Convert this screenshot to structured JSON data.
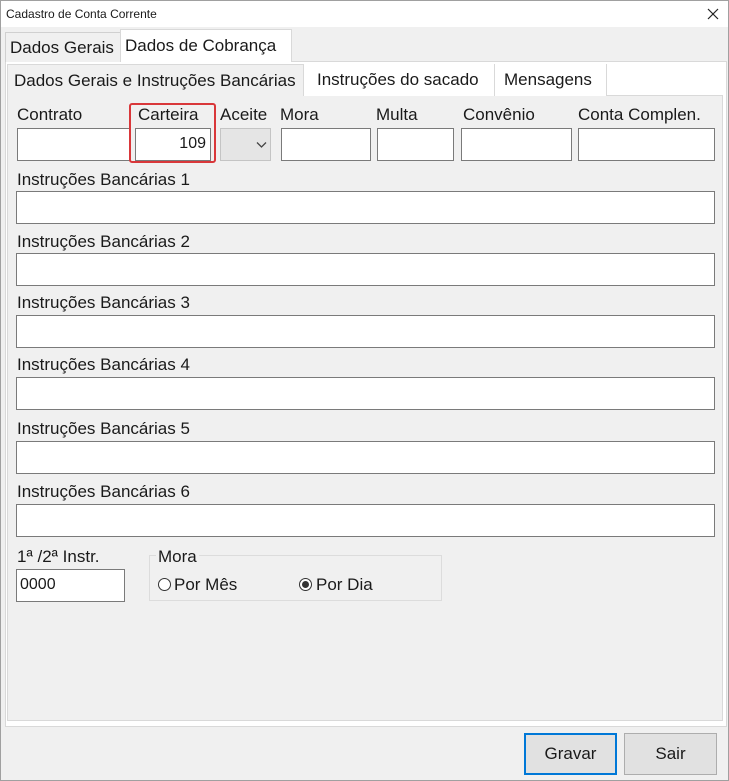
{
  "window": {
    "title": "Cadastro de Conta Corrente"
  },
  "outer_tabs": [
    {
      "label": "Dados Gerais"
    },
    {
      "label": "Dados de Cobrança"
    }
  ],
  "inner_tabs": [
    {
      "label": "Dados Gerais e Instruções Bancárias"
    },
    {
      "label": "Instruções do sacado"
    },
    {
      "label": "Mensagens"
    }
  ],
  "fields": {
    "contrato": {
      "label": "Contrato",
      "value": ""
    },
    "carteira": {
      "label": "Carteira",
      "value": "109"
    },
    "aceite": {
      "label": "Aceite",
      "value": ""
    },
    "mora": {
      "label": "Mora",
      "value": ""
    },
    "multa": {
      "label": "Multa",
      "value": ""
    },
    "convenio": {
      "label": "Convênio",
      "value": ""
    },
    "conta_complen": {
      "label": "Conta Complen.",
      "value": ""
    }
  },
  "instrucoes": [
    {
      "label": "Instruções Bancárias 1",
      "value": ""
    },
    {
      "label": "Instruções Bancárias 2",
      "value": ""
    },
    {
      "label": "Instruções Bancárias 3",
      "value": ""
    },
    {
      "label": "Instruções Bancárias 4",
      "value": ""
    },
    {
      "label": "Instruções Bancárias 5",
      "value": ""
    },
    {
      "label": "Instruções Bancárias 6",
      "value": ""
    }
  ],
  "instr_12": {
    "label": "1ª /2ª Instr.",
    "value": "0000"
  },
  "mora_group": {
    "title": "Mora",
    "options": [
      {
        "label": "Por Mês",
        "checked": false
      },
      {
        "label": "Por Dia",
        "checked": true
      }
    ]
  },
  "buttons": {
    "save": "Gravar",
    "exit": "Sair"
  },
  "colors": {
    "highlight": "#d9373a",
    "default_button_border": "#0078d7"
  }
}
